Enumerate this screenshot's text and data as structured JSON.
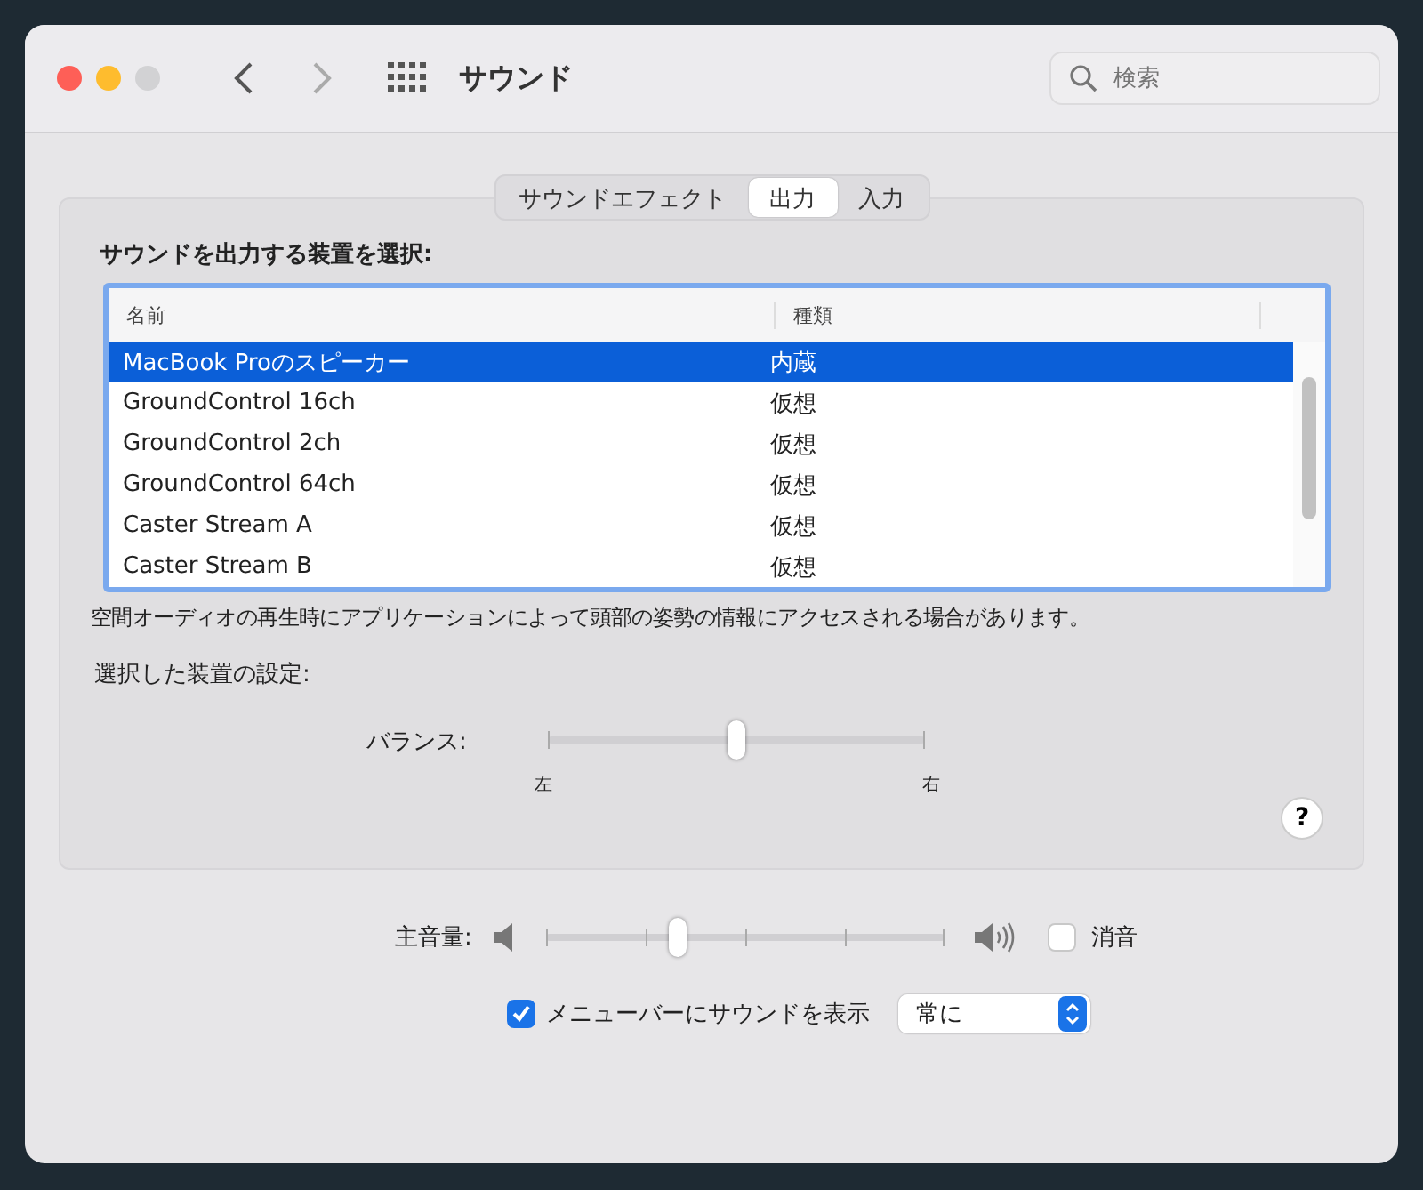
{
  "window": {
    "title": "サウンド",
    "search": {
      "placeholder": "検索"
    }
  },
  "tabs": [
    {
      "label": "サウンドエフェクト",
      "selected": false
    },
    {
      "label": "出力",
      "selected": true
    },
    {
      "label": "入力",
      "selected": false
    }
  ],
  "output": {
    "heading": "サウンドを出力する装置を選択:",
    "table": {
      "columns": [
        "名前",
        "種類"
      ],
      "rows": [
        {
          "name": "MacBook Proのスピーカー",
          "type": "内蔵",
          "selected": true
        },
        {
          "name": "GroundControl 16ch",
          "type": "仮想",
          "selected": false
        },
        {
          "name": "GroundControl 2ch",
          "type": "仮想",
          "selected": false
        },
        {
          "name": "GroundControl 64ch",
          "type": "仮想",
          "selected": false
        },
        {
          "name": "Caster Stream A",
          "type": "仮想",
          "selected": false
        },
        {
          "name": "Caster Stream B",
          "type": "仮想",
          "selected": false
        }
      ]
    },
    "notice": "空間オーディオの再生時にアプリケーションによって頭部の姿勢の情報にアクセスされる場合があります。",
    "settings_label": "選択した装置の設定:",
    "balance": {
      "label": "バランス:",
      "level": 0.5,
      "left": "左",
      "right": "右"
    },
    "help": "?"
  },
  "volume": {
    "label": "主音量:",
    "level": 0.33,
    "mute_label": "消音",
    "muted": false
  },
  "menubar": {
    "label": "メニューバーにサウンドを表示",
    "checked": true,
    "value": "常に"
  }
}
